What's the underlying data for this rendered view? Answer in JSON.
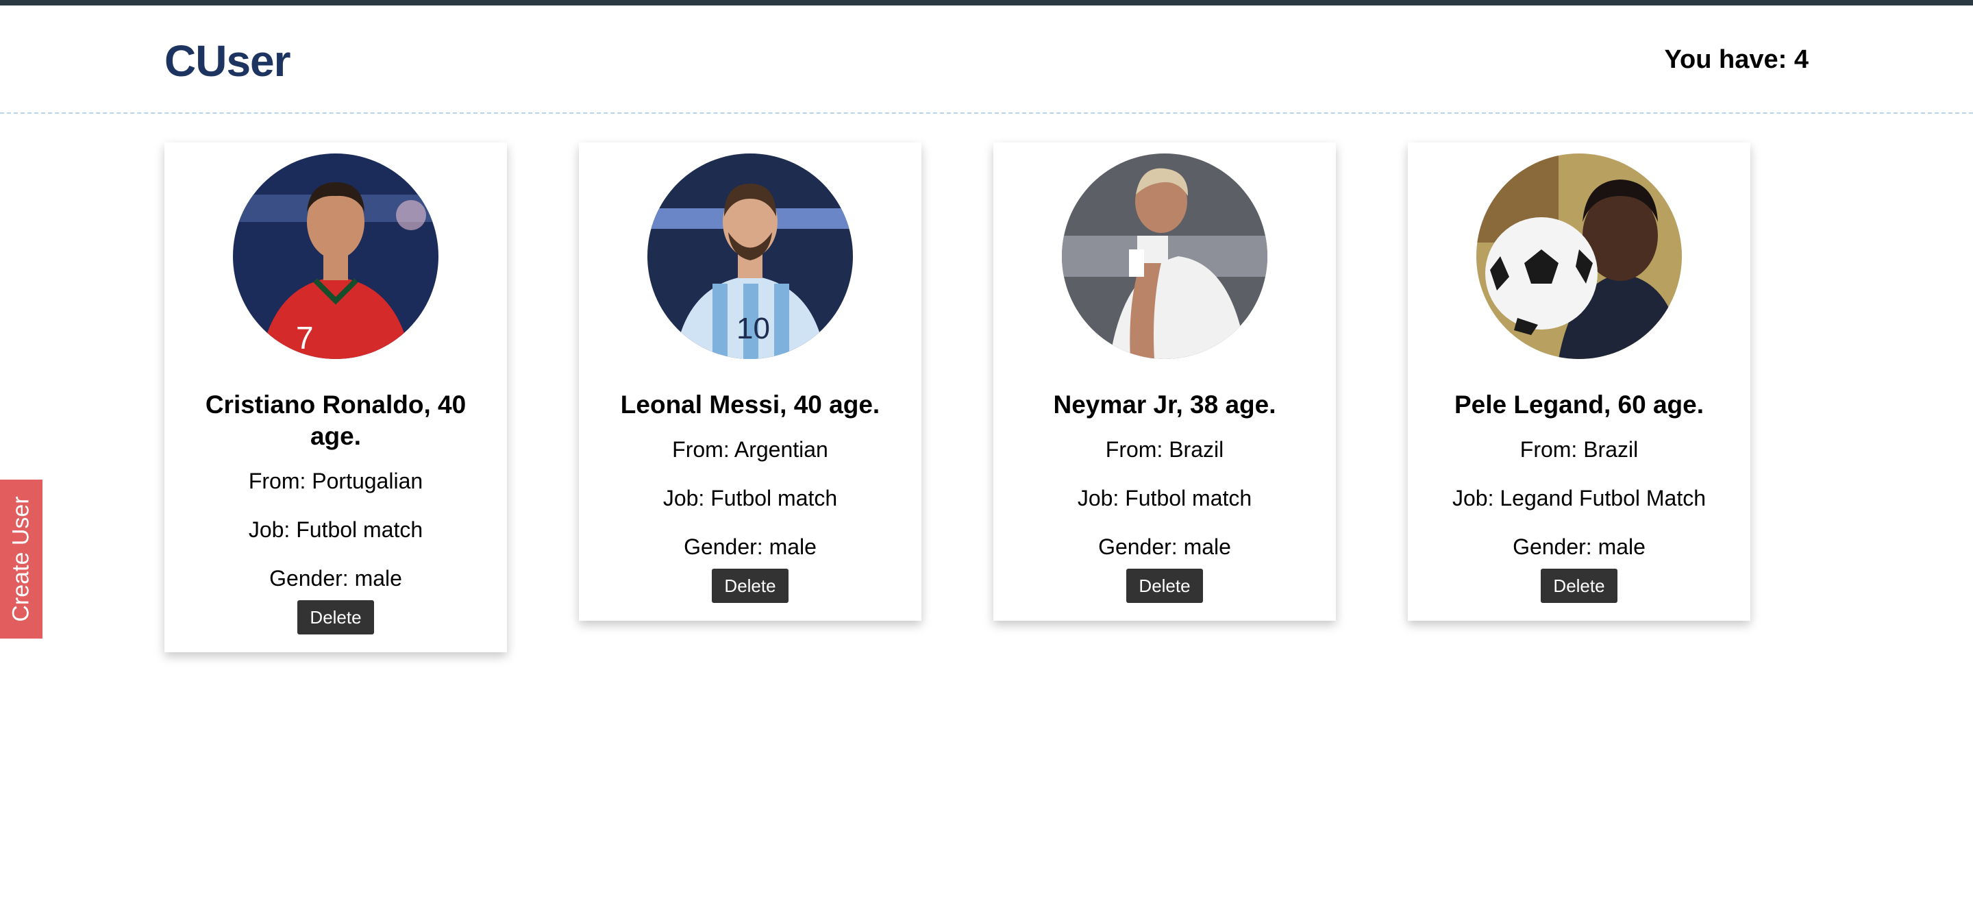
{
  "header": {
    "logo": "CUser",
    "count_label": "You have: 4"
  },
  "sidebar_tab": {
    "label": "Create User"
  },
  "users": [
    {
      "name_line": "Cristiano Ronaldo, 40 age.",
      "from": "From: Portugalian",
      "job": "Job: Futbol match",
      "gender": "Gender: male",
      "delete_label": "Delete",
      "avatar_colors": {
        "bg": "#1b2b5a",
        "shirt": "#d42a2a",
        "skin": "#c98f6d",
        "hair": "#2a1d16"
      }
    },
    {
      "name_line": "Leonal Messi, 40 age.",
      "from": "From: Argentian",
      "job": "Job: Futbol match",
      "gender": "Gender: male",
      "delete_label": "Delete",
      "avatar_colors": {
        "bg": "#1d2c4f",
        "shirt": "#cfe3f5",
        "skin": "#d9a889",
        "hair": "#4a3222"
      }
    },
    {
      "name_line": "Neymar Jr, 38 age.",
      "from": "From: Brazil",
      "job": "Job: Futbol match",
      "gender": "Gender: male",
      "delete_label": "Delete",
      "avatar_colors": {
        "bg": "#5d5f66",
        "shirt": "#f1f1f1",
        "skin": "#b98467",
        "hair": "#d9c9a8"
      }
    },
    {
      "name_line": "Pele Legand, 60 age.",
      "from": "From: Brazil",
      "job": "Job: Legand Futbol Match",
      "gender": "Gender: male",
      "delete_label": "Delete",
      "avatar_colors": {
        "bg": "#b8a060",
        "shirt": "#1e2538",
        "skin": "#4a2e22",
        "hair": "#1a1210"
      }
    }
  ]
}
